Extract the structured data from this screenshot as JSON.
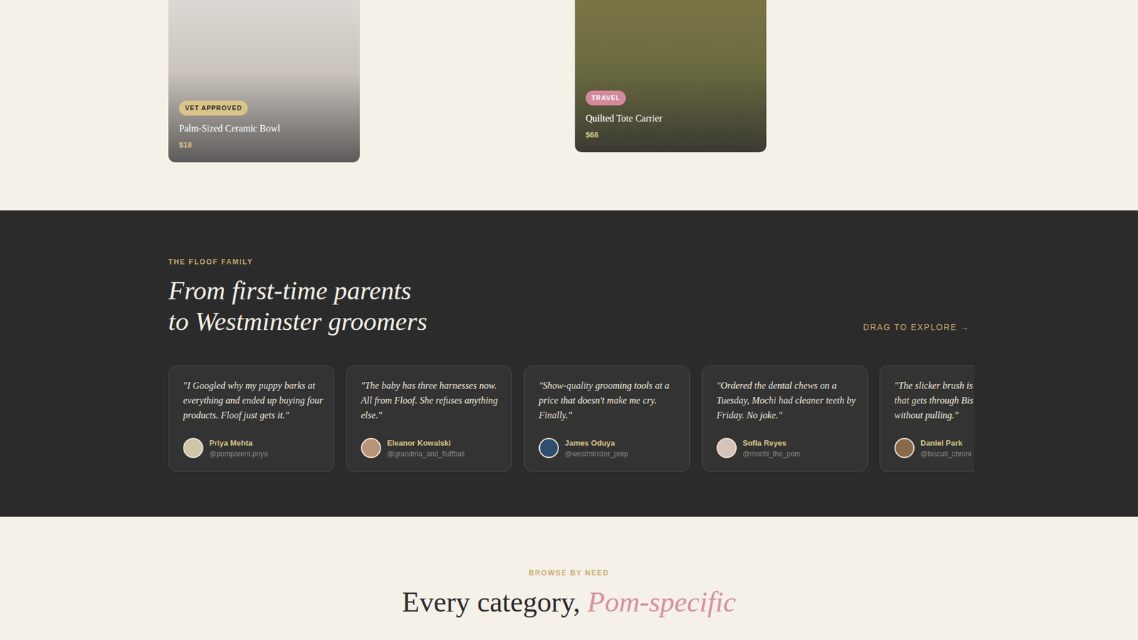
{
  "products": [
    {
      "badge": "VET APPROVED",
      "color": "#d9c48a",
      "name": "Palm-Sized Ceramic Bowl",
      "price": "$18"
    },
    {
      "badge": "TRAVEL",
      "color": "#d4899a",
      "name": "Quilted Tote Carrier",
      "price": "$68"
    }
  ],
  "testimonials": {
    "eyebrow": "THE FLOOF FAMILY",
    "heading_lines": [
      "From first-time parents",
      "to Westminster groomers"
    ],
    "hint": "DRAG TO EXPLORE →",
    "cards": [
      {
        "kind": "full",
        "lines": [
          "\"I Googled why my puppy barks at",
          "everything and ended up buying four",
          "products. Floof just gets it.\""
        ],
        "name": "Priya Mehta",
        "handle": "@pomparent.priya"
      },
      {
        "kind": "full",
        "lines": [
          "\"The baby has three harnesses now.",
          "All from Floof. She refuses anything",
          "else.\""
        ],
        "name": "Eleanor Kowalski",
        "handle": "@grandma_and_fluffball"
      },
      {
        "kind": "full",
        "lines": [
          "\"Show-quality grooming tools at a",
          "price that doesn't make me cry.",
          "Finally.\""
        ],
        "name": "James Oduya",
        "handle": "@westminster_prep"
      },
      {
        "kind": "full",
        "lines": [
          "\"Ordered the dental chews on a",
          "Tuesday, Mochi had cleaner teeth by",
          "Friday. No joke.\""
        ],
        "name": "Sofia Reyes",
        "handle": "@mochi_the_pom"
      },
      {
        "kind": "partial",
        "lines": [
          "\"The slicker brush is",
          "that gets through Bis",
          "without pulling.\""
        ],
        "name": "Daniel Park",
        "handle": "@biscuit_chroni"
      }
    ]
  },
  "categories": {
    "eyebrow": "BROWSE BY NEED",
    "heading": "Every category, ",
    "heading_accent": "Pom-specific"
  }
}
